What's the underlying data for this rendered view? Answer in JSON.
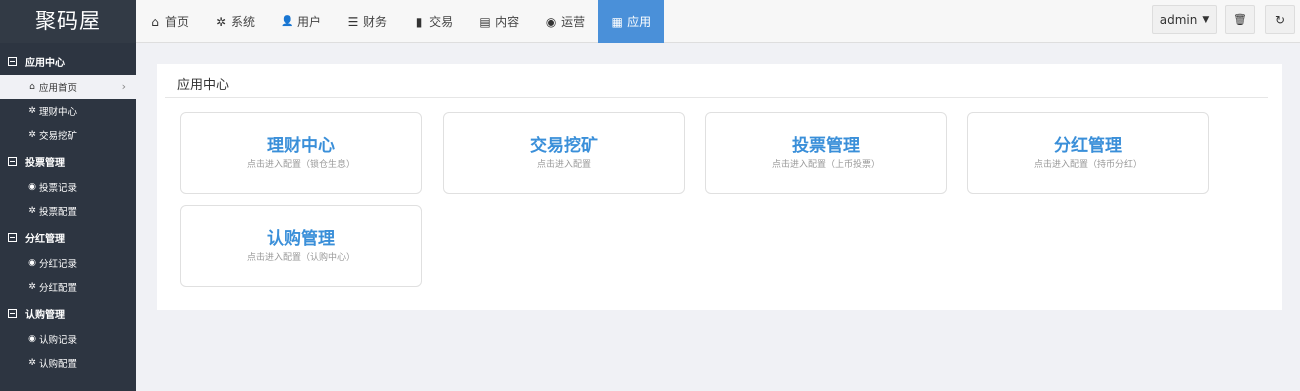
{
  "logo": "聚码屋",
  "nav": [
    {
      "icon": "home-icon",
      "glyph": "⌂",
      "label": "首页"
    },
    {
      "icon": "gear-icon",
      "glyph": "✲",
      "label": "系统"
    },
    {
      "icon": "user-icon",
      "glyph": "👤",
      "label": "用户"
    },
    {
      "icon": "list-icon",
      "glyph": "☰",
      "label": "财务"
    },
    {
      "icon": "bar-chart-icon",
      "glyph": "▮",
      "label": "交易"
    },
    {
      "icon": "document-icon",
      "glyph": "▤",
      "label": "内容"
    },
    {
      "icon": "globe-icon",
      "glyph": "◉",
      "label": "运营"
    },
    {
      "icon": "grid-icon",
      "glyph": "▦",
      "label": "应用",
      "active": true
    }
  ],
  "top_right": {
    "user": "admin",
    "user_caret": "▼",
    "trash_glyph": "🗑",
    "logout_glyph": "↻"
  },
  "sidebar": {
    "groups": [
      {
        "label": "应用中心",
        "items": [
          {
            "icon": "home-icon",
            "glyph": "⌂",
            "label": "应用首页",
            "active": true,
            "chevron": "›"
          },
          {
            "icon": "gear-icon",
            "glyph": "✲",
            "label": "理财中心"
          },
          {
            "icon": "gear-icon",
            "glyph": "✲",
            "label": "交易挖矿"
          }
        ]
      },
      {
        "label": "投票管理",
        "items": [
          {
            "icon": "globe-icon",
            "glyph": "◉",
            "label": "投票记录"
          },
          {
            "icon": "gear-icon",
            "glyph": "✲",
            "label": "投票配置"
          }
        ]
      },
      {
        "label": "分红管理",
        "items": [
          {
            "icon": "globe-icon",
            "glyph": "◉",
            "label": "分红记录"
          },
          {
            "icon": "gear-icon",
            "glyph": "✲",
            "label": "分红配置"
          }
        ]
      },
      {
        "label": "认购管理",
        "items": [
          {
            "icon": "globe-icon",
            "glyph": "◉",
            "label": "认购记录"
          },
          {
            "icon": "gear-icon",
            "glyph": "✲",
            "label": "认购配置"
          }
        ]
      }
    ]
  },
  "main": {
    "title": "应用中心",
    "cards": [
      {
        "title": "理财中心",
        "sub": "点击进入配置（锁仓生息）"
      },
      {
        "title": "交易挖矿",
        "sub": "点击进入配置"
      },
      {
        "title": "投票管理",
        "sub": "点击进入配置（上币投票）"
      },
      {
        "title": "分红管理",
        "sub": "点击进入配置（持币分红）"
      },
      {
        "title": "认购管理",
        "sub": "点击进入配置（认购中心）"
      }
    ]
  },
  "colors": {
    "accent": "#4a90d9",
    "card_title": "#3a8fd9",
    "sidebar_bg": "#2d3541",
    "logo_bg": "#323a45"
  }
}
